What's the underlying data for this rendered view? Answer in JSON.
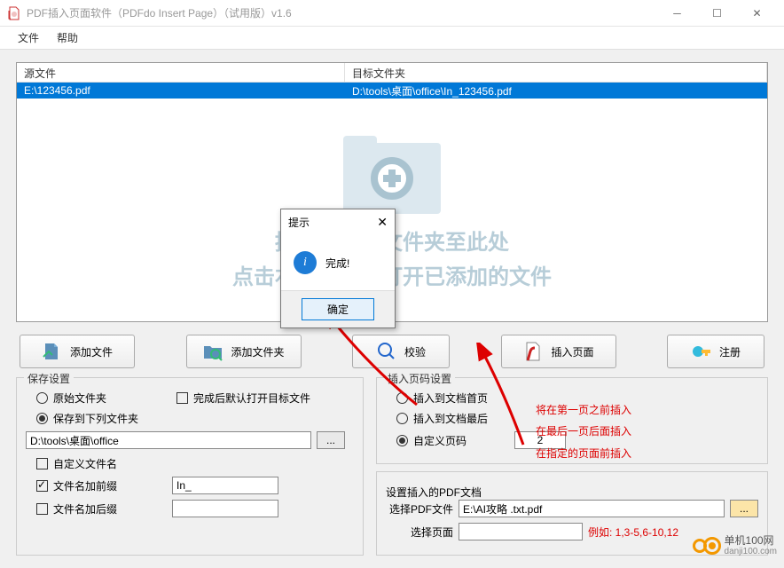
{
  "window": {
    "title": "PDF插入页面软件（PDFdo Insert Page）（试用版）v1.6"
  },
  "menu": {
    "file": "文件",
    "help": "帮助"
  },
  "table": {
    "col1": "源文件",
    "col2": "目标文件夹",
    "row1_src": "E:\\123456.pdf",
    "row1_dst": "D:\\tools\\桌面\\office\\In_123456.pdf"
  },
  "drop": {
    "line1": "拖拽文件或文件夹至此处",
    "line2": "点击右键删除或打开已添加的文件"
  },
  "buttons": {
    "addfile": "添加文件",
    "addfolder": "添加文件夹",
    "verify": "校验",
    "insert": "插入页面",
    "register": "注册"
  },
  "save": {
    "legend": "保存设置",
    "open_after": "完成后默认打开目标文件",
    "orig_folder": "原始文件夹",
    "save_to": "保存到下列文件夹",
    "path": "D:\\tools\\桌面\\office",
    "browse": "...",
    "custom_name": "自定义文件名",
    "prefix": "文件名加前缀",
    "prefix_val": "In_",
    "suffix": "文件名加后缀"
  },
  "pagenum": {
    "legend": "插入页码设置",
    "first": "插入到文档首页",
    "last": "插入到文档最后",
    "custom": "自定义页码",
    "page_val": "2"
  },
  "notes": {
    "n1": "将在第一页之前插入",
    "n2": "在最后一页后面插入",
    "n3": "在指定的页面前插入"
  },
  "pdfset": {
    "legend": "设置插入的PDF文档",
    "choose_pdf": "选择PDF文件",
    "pdf_path": "E:\\AI攻略 .txt.pdf",
    "browse": "...",
    "choose_page": "选择页面",
    "example": "例如: 1,3-5,6-10,12"
  },
  "dialog": {
    "title": "提示",
    "msg": "完成!",
    "ok": "确定"
  },
  "watermark": "单机100网\ndanji100.com"
}
